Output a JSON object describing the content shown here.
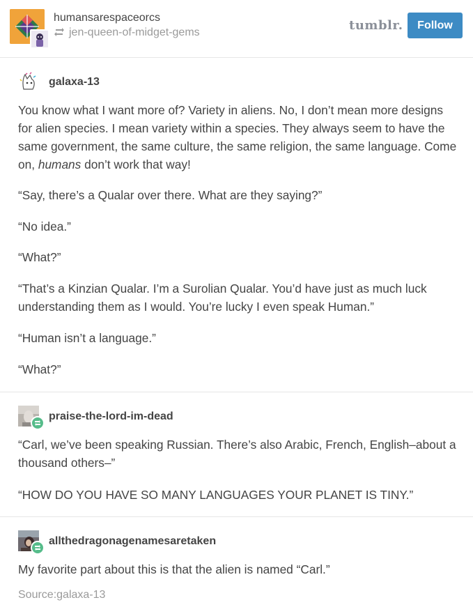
{
  "header": {
    "blog_name": "humansarespaceorcs",
    "reblogged_from": "jen-queen-of-midget-gems",
    "brand": "tumblr.",
    "follow_label": "Follow"
  },
  "posts": [
    {
      "username": "galaxa-13",
      "paragraphs": [
        {
          "before": "You know what I want more of? Variety in aliens. No, I don’t mean more designs for alien species. I mean variety within a species. They always seem to have the same government, the same culture, the same religion, the same language. Come on, ",
          "italic": "humans",
          "after": " don’t work that way!"
        },
        "“Say, there’s a Qualar over there. What are they saying?”",
        "“No idea.”",
        "“What?”",
        "“That’s a Kinzian Qualar. I’m a Surolian Qualar. You’d have just as much luck understanding them as I would. You’re lucky I even speak Human.”",
        "“Human isn’t a language.”",
        "“What?”"
      ]
    },
    {
      "username": "praise-the-lord-im-dead",
      "paragraphs": [
        "“Carl, we’ve been speaking Russian. There’s also Arabic, French, English–about a thousand others–”",
        "“HOW DO YOU HAVE SO MANY LANGUAGES YOUR PLANET IS TINY.”"
      ]
    },
    {
      "username": "allthedragonagenamesaretaken",
      "paragraphs": [
        "My favorite part about this is that the alien is named “Carl.”"
      ]
    }
  ],
  "source": "Source:galaxa-13",
  "colors": {
    "follow_button": "#3d8bc4",
    "reblog_badge": "#56bc8a",
    "text": "#444444",
    "muted": "#9a9a9a"
  },
  "icons": [
    "reblog-icon",
    "blog-avatar",
    "user-avatar",
    "reblog-badge-icon"
  ]
}
